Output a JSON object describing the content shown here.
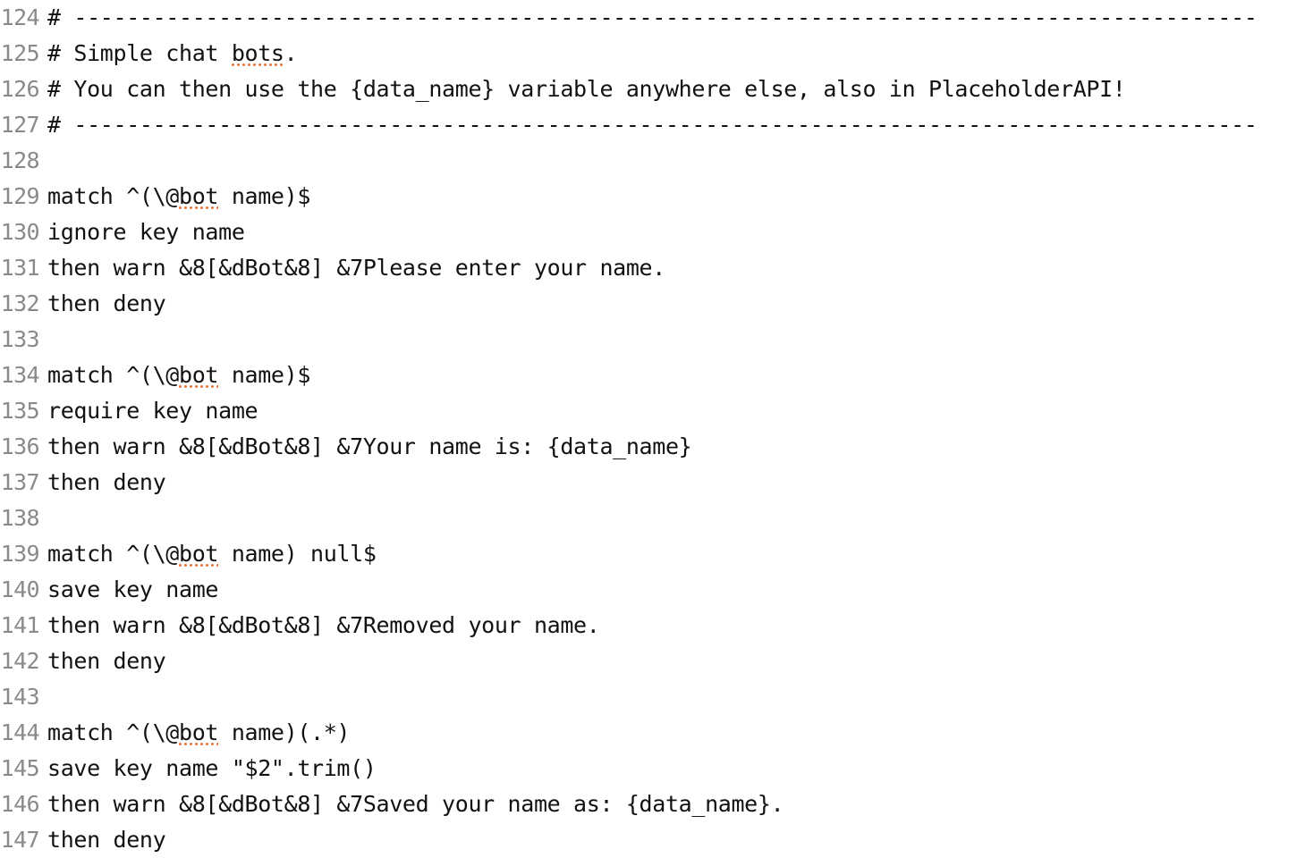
{
  "editor": {
    "title": "code-editor",
    "line_number_color": "#8a8a8a",
    "code_color": "#111111",
    "spellcheck_underline_color": "#e8793c",
    "background_color": "#ffffff",
    "lines": [
      {
        "number": "124",
        "text": "# ------------------------------------------------------------------------------------------"
      },
      {
        "number": "125",
        "pre": "# Simple chat ",
        "spell": "bots",
        "post": "."
      },
      {
        "number": "126",
        "text": "# You can then use the {data_name} variable anywhere else, also in PlaceholderAPI!"
      },
      {
        "number": "127",
        "text": "# ------------------------------------------------------------------------------------------"
      },
      {
        "number": "128",
        "text": ""
      },
      {
        "number": "129",
        "pre": "match ^(\\@",
        "spell": "bot",
        "post": " name)$"
      },
      {
        "number": "130",
        "text": "ignore key name"
      },
      {
        "number": "131",
        "text": "then warn &8[&dBot&8] &7Please enter your name."
      },
      {
        "number": "132",
        "text": "then deny"
      },
      {
        "number": "133",
        "text": ""
      },
      {
        "number": "134",
        "pre": "match ^(\\@",
        "spell": "bot",
        "post": " name)$"
      },
      {
        "number": "135",
        "text": "require key name"
      },
      {
        "number": "136",
        "text": "then warn &8[&dBot&8] &7Your name is: {data_name}"
      },
      {
        "number": "137",
        "text": "then deny"
      },
      {
        "number": "138",
        "text": ""
      },
      {
        "number": "139",
        "pre": "match ^(\\@",
        "spell": "bot",
        "post": " name) null$"
      },
      {
        "number": "140",
        "text": "save key name"
      },
      {
        "number": "141",
        "text": "then warn &8[&dBot&8] &7Removed your name."
      },
      {
        "number": "142",
        "text": "then deny"
      },
      {
        "number": "143",
        "text": ""
      },
      {
        "number": "144",
        "pre": "match ^(\\@",
        "spell": "bot",
        "post": " name)(.*)"
      },
      {
        "number": "145",
        "text": "save key name \"$2\".trim()"
      },
      {
        "number": "146",
        "text": "then warn &8[&dBot&8] &7Saved your name as: {data_name}."
      },
      {
        "number": "147",
        "text": "then deny"
      }
    ]
  }
}
